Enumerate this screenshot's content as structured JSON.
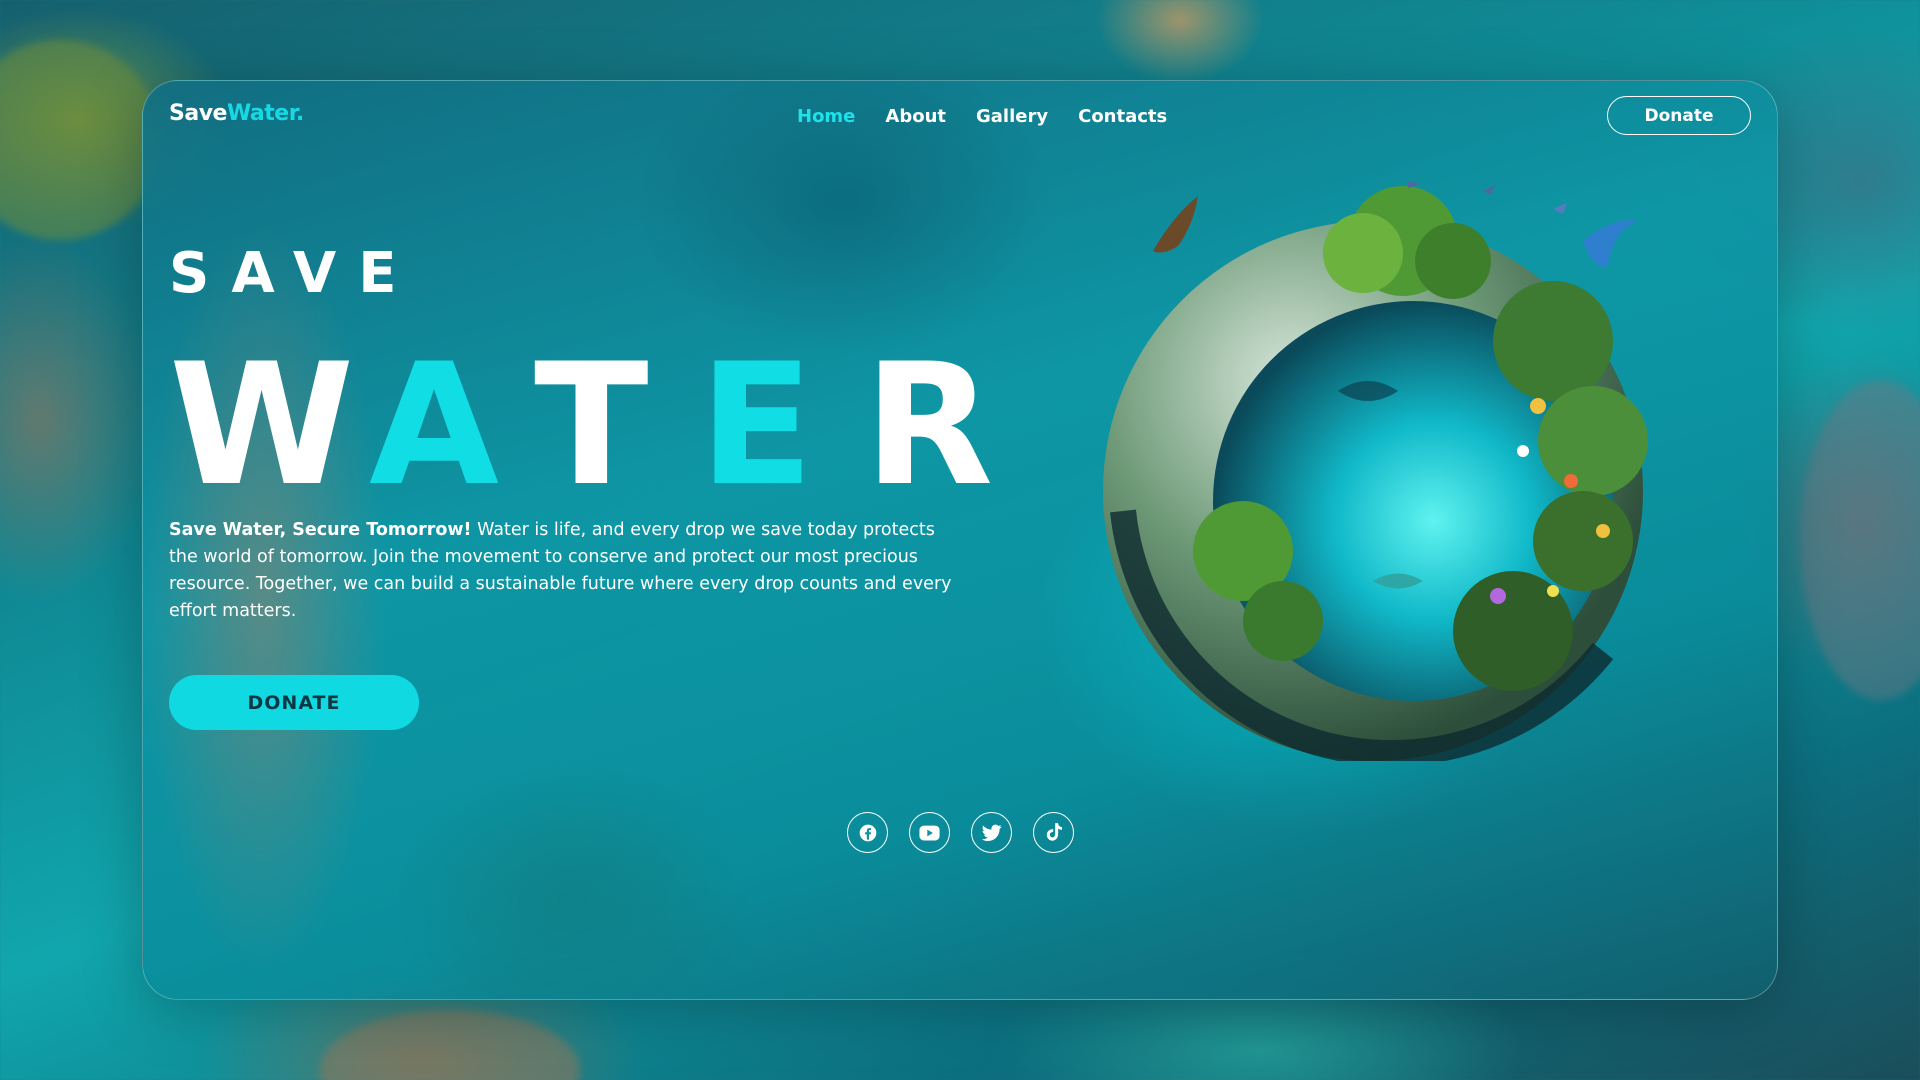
{
  "brand": {
    "part1": "Save",
    "part2": "Water."
  },
  "nav": {
    "items": [
      {
        "label": "Home",
        "active": true
      },
      {
        "label": "About",
        "active": false
      },
      {
        "label": "Gallery",
        "active": false
      },
      {
        "label": "Contacts",
        "active": false
      }
    ],
    "donate_label": "Donate"
  },
  "hero": {
    "eyebrow": "SAVE",
    "title_letters": [
      "W",
      "A",
      "T",
      "E",
      "R"
    ],
    "description_lead": "Save Water, Secure Tomorrow!",
    "description_body": " Water is life, and every drop we save today protects the world of tomorrow. Join the movement to conserve and protect our most precious resource. Together, we can build a sustainable future where every drop counts and every effort matters.",
    "cta_label": "DONATE"
  },
  "socials": [
    {
      "icon": "facebook-icon"
    },
    {
      "icon": "youtube-icon"
    },
    {
      "icon": "twitter-icon"
    },
    {
      "icon": "tiktok-icon"
    }
  ],
  "colors": {
    "accent": "#10dde4",
    "text": "#ffffff",
    "button_text": "#0b3844"
  }
}
